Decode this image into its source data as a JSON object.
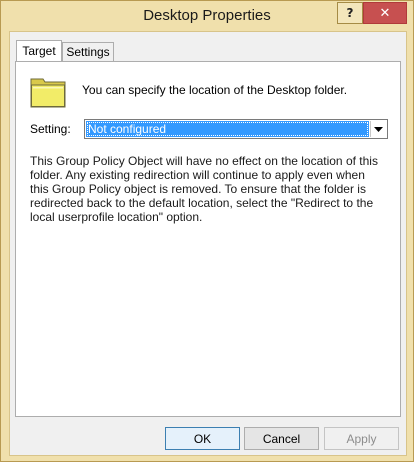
{
  "window": {
    "title": "Desktop Properties",
    "help_label": "?",
    "close_label": "✕",
    "frame_color": "#f0e0ac"
  },
  "tabs": [
    {
      "label": "Target",
      "active": true
    },
    {
      "label": "Settings",
      "active": false
    }
  ],
  "target": {
    "folder_icon": "folder-icon",
    "info_text": "You can specify the location of the Desktop folder.",
    "setting_label": "Setting:",
    "setting_value": "Not configured",
    "description": "This Group Policy Object will have no effect on the location of this folder. Any existing redirection will continue to apply even when this Group Policy object is removed. To ensure that the folder is redirected back to the default location, select the \"Redirect to the local userprofile location\" option."
  },
  "buttons": {
    "ok": "OK",
    "cancel": "Cancel",
    "apply": "Apply",
    "apply_enabled": false
  }
}
